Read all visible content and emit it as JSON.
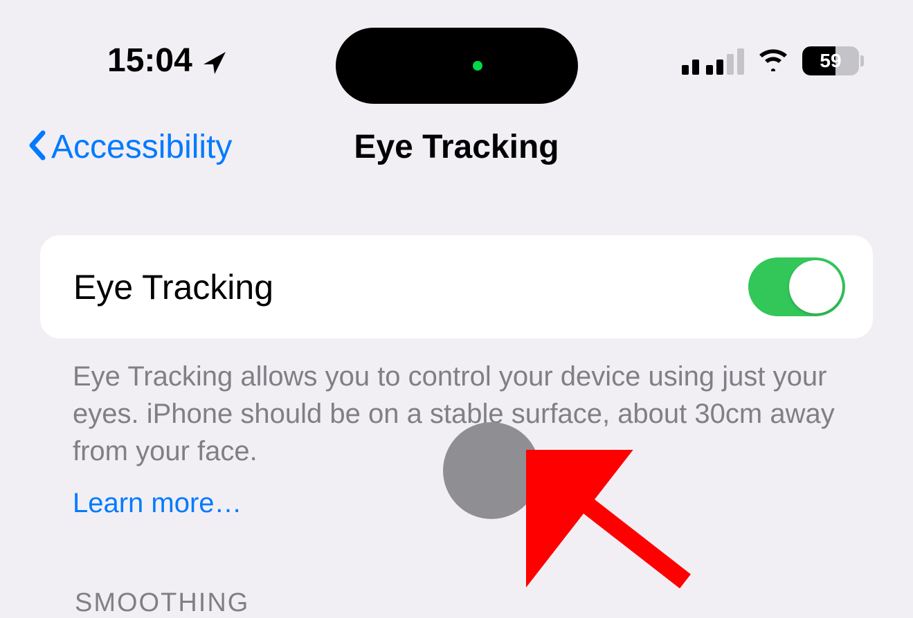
{
  "status": {
    "time": "15:04",
    "battery_percent": "59"
  },
  "nav": {
    "back_label": "Accessibility",
    "title": "Eye Tracking"
  },
  "settings": {
    "eye_tracking_label": "Eye Tracking",
    "eye_tracking_on": true,
    "description": "Eye Tracking allows you to control your device using just your eyes. iPhone should be on a stable surface, about 30cm away from your face.",
    "learn_more_label": "Learn more…"
  },
  "sections": {
    "smoothing_header": "SMOOTHING"
  },
  "colors": {
    "link": "#007aff",
    "toggle_on": "#33c759",
    "annotation_red": "#ff0000"
  }
}
